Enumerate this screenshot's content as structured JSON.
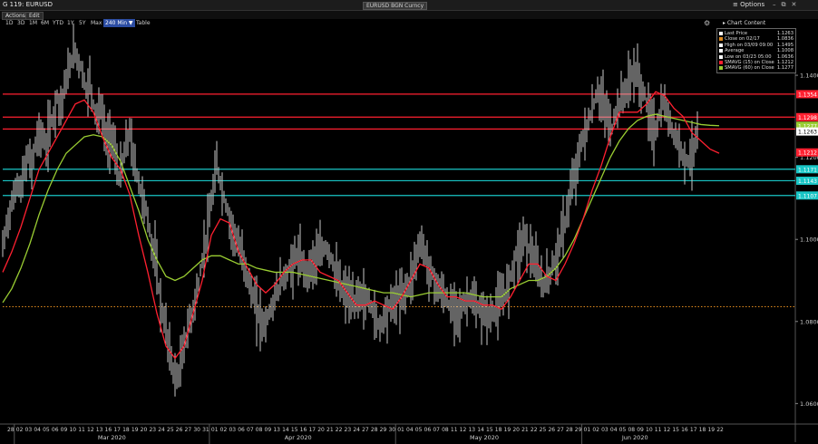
{
  "window": {
    "title": "G 119: EURUSD",
    "ticker_field": "EURUSD BGN Curncy",
    "options_label": "Options",
    "controls": [
      "–",
      "⧉",
      "✕"
    ]
  },
  "menu": {
    "actions": "Actions",
    "edit": "Edit"
  },
  "range_buttons": [
    "1D",
    "3D",
    "1M",
    "6M",
    "YTD",
    "1Y",
    "5Y",
    "Max"
  ],
  "interval": "240 Min ▼",
  "table_label": "Table",
  "chart_content_label": "Chart Content",
  "legend": [
    {
      "label": "Last Price",
      "value": "1.1263",
      "color": "#ffffff"
    },
    {
      "label": "Close on 02/17",
      "value": "1.0836",
      "color": "#e08a1e"
    },
    {
      "label": "High on 03/09 09:00",
      "value": "1.1495",
      "color": "#ffffff"
    },
    {
      "label": "Average",
      "value": "1.1008",
      "color": "#ffffff"
    },
    {
      "label": "Low on 03/23 05:00",
      "value": "1.0636",
      "color": "#ffffff"
    },
    {
      "label": "SMAVG (15)  on Close",
      "value": "1.1212",
      "color": "#ff2030"
    },
    {
      "label": "SMAVG (60)  on Close",
      "value": "1.1277",
      "color": "#9acd32"
    }
  ],
  "chart_data": {
    "type": "line",
    "subtype": "price-bars-with-moving-averages",
    "ylim": [
      1.055,
      1.1515
    ],
    "y_ticks": [
      "1.1400",
      "1.1200",
      "1.1000",
      "1.0800",
      "1.0600"
    ],
    "y_tick_values": [
      1.14,
      1.12,
      1.1,
      1.08,
      1.06
    ],
    "x_day_labels": [
      "28",
      "02",
      "03",
      "04",
      "05",
      "06",
      "09",
      "10",
      "11",
      "12",
      "13",
      "16",
      "17",
      "18",
      "19",
      "20",
      "23",
      "24",
      "25",
      "26",
      "27",
      "30",
      "31",
      "01",
      "02",
      "03",
      "06",
      "07",
      "08",
      "09",
      "13",
      "14",
      "15",
      "16",
      "17",
      "20",
      "21",
      "22",
      "23",
      "24",
      "27",
      "28",
      "29",
      "30",
      "01",
      "04",
      "05",
      "06",
      "07",
      "08",
      "11",
      "12",
      "13",
      "14",
      "15",
      "18",
      "19",
      "20",
      "21",
      "22",
      "25",
      "26",
      "27",
      "28",
      "29",
      "01",
      "02",
      "03",
      "04",
      "05",
      "08",
      "09",
      "10",
      "11",
      "12",
      "15",
      "16",
      "17",
      "18",
      "19",
      "22"
    ],
    "x_month_labels": [
      "Mar 2020",
      "Apr 2020",
      "May 2020",
      "Jun 2020"
    ],
    "price": {
      "x": [
        0,
        4,
        8,
        12,
        16,
        20,
        24,
        28,
        32,
        36,
        40,
        44,
        48,
        52,
        56,
        60,
        64,
        68,
        72,
        76,
        80,
        84,
        88,
        92,
        96,
        100,
        104,
        108,
        112,
        116,
        120,
        124,
        128,
        132,
        136,
        140,
        144,
        148,
        152,
        156,
        160,
        164,
        168,
        172,
        176,
        180,
        184,
        188,
        192,
        196,
        200,
        204,
        208,
        212,
        216,
        220,
        224,
        228,
        232,
        236,
        240,
        244,
        248,
        252,
        256,
        260,
        264,
        268,
        272,
        276,
        280,
        284,
        288,
        292,
        296,
        300,
        304,
        308,
        312,
        316,
        320,
        324,
        328,
        332,
        336,
        340,
        344,
        348,
        352,
        356,
        360,
        364,
        368,
        372,
        376,
        380,
        384,
        388,
        392,
        396,
        400,
        404,
        408,
        412,
        416,
        420,
        424,
        428,
        432,
        436,
        440,
        444,
        448,
        452,
        456,
        460,
        464,
        468,
        472,
        476,
        480,
        484,
        488,
        492,
        496,
        500,
        504,
        508,
        512,
        516,
        520,
        524,
        528,
        532,
        536,
        540,
        544,
        548,
        552,
        556,
        560,
        564,
        568,
        572,
        576,
        580,
        584,
        588,
        592,
        596,
        600,
        604,
        608,
        612,
        616,
        620,
        624,
        628,
        632,
        636,
        640,
        644,
        648,
        652,
        656,
        660,
        664,
        668,
        672,
        676,
        680,
        684,
        688,
        692,
        696,
        700,
        704,
        708,
        712,
        716,
        720,
        724,
        728,
        732,
        736,
        740,
        744,
        748,
        752,
        756,
        760,
        764,
        768,
        772,
        776,
        780,
        784,
        788,
        792
      ],
      "y": [
        1.098,
        1.103,
        1.107,
        1.11,
        1.114,
        1.112,
        1.117,
        1.12,
        1.118,
        1.123,
        1.126,
        1.125,
        1.122,
        1.128,
        1.13,
        1.135,
        1.132,
        1.137,
        1.14,
        1.144,
        1.146,
        1.143,
        1.141,
        1.136,
        1.139,
        1.133,
        1.13,
        1.132,
        1.127,
        1.123,
        1.126,
        1.121,
        1.115,
        1.118,
        1.123,
        1.126,
        1.12,
        1.116,
        1.112,
        1.109,
        1.105,
        1.099,
        1.096,
        1.088,
        1.082,
        1.078,
        1.073,
        1.068,
        1.066,
        1.069,
        1.074,
        1.078,
        1.081,
        1.085,
        1.089,
        1.095,
        1.1,
        1.105,
        1.112,
        1.118,
        1.114,
        1.11,
        1.107,
        1.103,
        1.101,
        1.098,
        1.096,
        1.093,
        1.089,
        1.086,
        1.083,
        1.081,
        1.079,
        1.081,
        1.083,
        1.086,
        1.088,
        1.09,
        1.091,
        1.093,
        1.094,
        1.096,
        1.095,
        1.093,
        1.092,
        1.094,
        1.095,
        1.096,
        1.097,
        1.098,
        1.097,
        1.094,
        1.091,
        1.089,
        1.087,
        1.087,
        1.085,
        1.084,
        1.087,
        1.086,
        1.085,
        1.085,
        1.083,
        1.08,
        1.079,
        1.081,
        1.083,
        1.084,
        1.085,
        1.086,
        1.086,
        1.088,
        1.089,
        1.092,
        1.096,
        1.099,
        1.098,
        1.094,
        1.092,
        1.09,
        1.088,
        1.087,
        1.086,
        1.084,
        1.083,
        1.084,
        1.082,
        1.084,
        1.085,
        1.086,
        1.084,
        1.083,
        1.082,
        1.082,
        1.081,
        1.082,
        1.083,
        1.085,
        1.086,
        1.088,
        1.091,
        1.095,
        1.097,
        1.099,
        1.101,
        1.098,
        1.096,
        1.093,
        1.091,
        1.089,
        1.09,
        1.092,
        1.094,
        1.097,
        1.101,
        1.104,
        1.109,
        1.113,
        1.117,
        1.121,
        1.125,
        1.127,
        1.13,
        1.133,
        1.136,
        1.134,
        1.132,
        1.129,
        1.127,
        1.131,
        1.133,
        1.135,
        1.137,
        1.139,
        1.141,
        1.14,
        1.137,
        1.135,
        1.131,
        1.128,
        1.126,
        1.13,
        1.133,
        1.131,
        1.128,
        1.126,
        1.124,
        1.122,
        1.12,
        1.119,
        1.121,
        1.124,
        1.126
      ]
    },
    "sma15": {
      "x": [
        0,
        10,
        20,
        30,
        40,
        50,
        60,
        70,
        80,
        90,
        100,
        110,
        120,
        130,
        140,
        150,
        160,
        170,
        180,
        190,
        200,
        210,
        220,
        230,
        240,
        250,
        260,
        270,
        280,
        290,
        300,
        310,
        320,
        330,
        340,
        350,
        360,
        370,
        380,
        390,
        400,
        410,
        420,
        430,
        440,
        450,
        460,
        470,
        480,
        490,
        500,
        510,
        520,
        530,
        540,
        550,
        560,
        570,
        580,
        590,
        600,
        610,
        620,
        630,
        640,
        650,
        660,
        670,
        680,
        690,
        700,
        710,
        720,
        730,
        740,
        750,
        760,
        770,
        780,
        790
      ],
      "y": [
        1.092,
        1.097,
        1.103,
        1.11,
        1.117,
        1.121,
        1.125,
        1.129,
        1.133,
        1.134,
        1.131,
        1.125,
        1.12,
        1.117,
        1.111,
        1.101,
        1.092,
        1.082,
        1.074,
        1.071,
        1.074,
        1.082,
        1.09,
        1.101,
        1.105,
        1.104,
        1.097,
        1.093,
        1.089,
        1.087,
        1.089,
        1.092,
        1.094,
        1.095,
        1.095,
        1.092,
        1.091,
        1.09,
        1.087,
        1.084,
        1.084,
        1.085,
        1.084,
        1.083,
        1.086,
        1.09,
        1.094,
        1.093,
        1.089,
        1.086,
        1.086,
        1.085,
        1.085,
        1.084,
        1.084,
        1.083,
        1.086,
        1.09,
        1.094,
        1.094,
        1.091,
        1.09,
        1.094,
        1.099,
        1.105,
        1.112,
        1.118,
        1.125,
        1.131,
        1.131,
        1.131,
        1.133,
        1.136,
        1.135,
        1.132,
        1.13,
        1.126,
        1.124,
        1.122,
        1.121
      ]
    },
    "sma60": {
      "x": [
        0,
        10,
        20,
        30,
        40,
        50,
        60,
        70,
        80,
        90,
        100,
        110,
        120,
        130,
        140,
        150,
        160,
        170,
        180,
        190,
        200,
        210,
        220,
        230,
        240,
        250,
        260,
        270,
        280,
        290,
        300,
        310,
        320,
        330,
        340,
        350,
        360,
        370,
        380,
        390,
        400,
        410,
        420,
        430,
        440,
        450,
        460,
        470,
        480,
        490,
        500,
        510,
        520,
        530,
        540,
        550,
        560,
        570,
        580,
        590,
        600,
        610,
        620,
        630,
        640,
        650,
        660,
        670,
        680,
        690,
        700,
        710,
        720,
        730,
        740,
        750,
        760,
        770,
        780,
        790
      ],
      "y": [
        1.0846,
        1.088,
        1.093,
        1.099,
        1.106,
        1.112,
        1.117,
        1.121,
        1.123,
        1.125,
        1.1255,
        1.125,
        1.123,
        1.119,
        1.113,
        1.107,
        1.1,
        1.095,
        1.091,
        1.09,
        1.091,
        1.093,
        1.095,
        1.096,
        1.096,
        1.095,
        1.094,
        1.094,
        1.093,
        1.0925,
        1.092,
        1.092,
        1.092,
        1.0915,
        1.091,
        1.0905,
        1.09,
        1.0895,
        1.089,
        1.0885,
        1.088,
        1.0875,
        1.087,
        1.087,
        1.0865,
        1.086,
        1.0865,
        1.087,
        1.087,
        1.087,
        1.087,
        1.087,
        1.0865,
        1.086,
        1.086,
        1.086,
        1.088,
        1.089,
        1.09,
        1.09,
        1.091,
        1.093,
        1.096,
        1.1,
        1.105,
        1.11,
        1.115,
        1.12,
        1.124,
        1.127,
        1.129,
        1.13,
        1.1305,
        1.13,
        1.1295,
        1.129,
        1.1285,
        1.128,
        1.1278,
        1.1277
      ]
    },
    "hlines": [
      {
        "value": 1.1354,
        "label": "1.1354",
        "color": "#ff2030"
      },
      {
        "value": 1.1298,
        "label": "1.1298",
        "color": "#ff2030"
      },
      {
        "value": 1.1269,
        "label": "1.1269",
        "color": "#ff2030"
      },
      {
        "value": 1.1171,
        "label": "1.1171",
        "color": "#19c6c6"
      },
      {
        "value": 1.1143,
        "label": "1.1143",
        "color": "#19c6c6"
      },
      {
        "value": 1.1107,
        "label": "1.1107",
        "color": "#19c6c6"
      }
    ],
    "marker_labels": [
      {
        "value": 1.1277,
        "label": "1.1277",
        "color": "#9acd32"
      },
      {
        "value": 1.1212,
        "label": "1.1212",
        "color": "#ff2030"
      },
      {
        "value": 1.1263,
        "label": "1.1263",
        "color": "#ffffff"
      }
    ],
    "reference_line": {
      "value": 1.0836,
      "color": "#e08a1e",
      "style": "dotted"
    }
  }
}
